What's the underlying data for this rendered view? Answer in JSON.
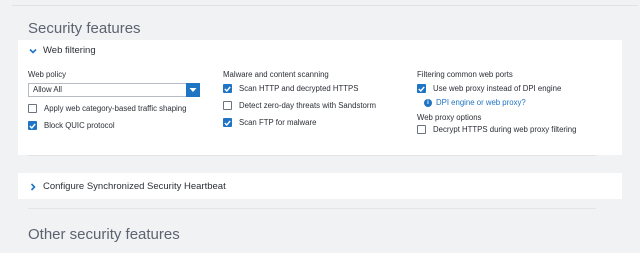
{
  "sections": {
    "security_features_title": "Security features",
    "other_security_features_title": "Other security features"
  },
  "web_filtering": {
    "title": "Web filtering",
    "expanded": true,
    "web_policy": {
      "label": "Web policy",
      "selected": "Allow All",
      "traffic_shaping": {
        "label": "Apply web category-based traffic shaping",
        "checked": false
      },
      "block_quic": {
        "label": "Block QUIC protocol",
        "checked": true
      }
    },
    "malware": {
      "label": "Malware and content scanning",
      "scan_http": {
        "label": "Scan HTTP and decrypted HTTPS",
        "checked": true
      },
      "zero_day": {
        "label": "Detect zero-day threats with Sandstorm",
        "checked": false
      },
      "scan_ftp": {
        "label": "Scan FTP for malware",
        "checked": true
      }
    },
    "ports": {
      "label": "Filtering common web ports",
      "use_proxy": {
        "label": "Use web proxy instead of DPI engine",
        "checked": true
      },
      "info_link": "DPI engine or web proxy?"
    },
    "proxy_options": {
      "label": "Web proxy options",
      "decrypt_https": {
        "label": "Decrypt HTTPS during web proxy filtering",
        "checked": false
      }
    }
  },
  "heartbeat": {
    "title": "Configure Synchronized Security Heartbeat",
    "expanded": false
  },
  "colors": {
    "accent": "#1f74c4",
    "panel": "#ffffff",
    "background": "#f1f2f4",
    "section_title": "#5c6370"
  }
}
